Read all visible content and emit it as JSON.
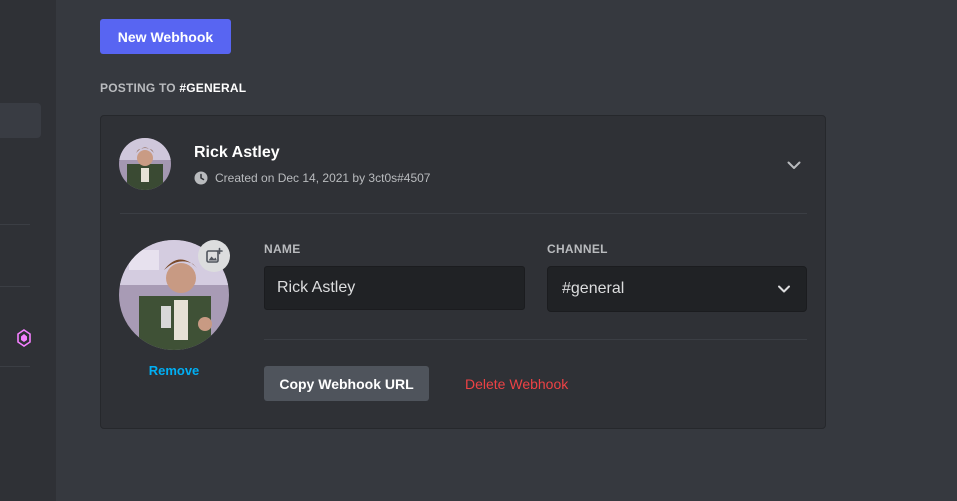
{
  "header": {
    "new_webhook_label": "New Webhook",
    "posting_prefix": "POSTING TO ",
    "posting_channel": "#GENERAL"
  },
  "webhook": {
    "name": "Rick Astley",
    "meta": "Created on Dec 14, 2021 by 3ct0s#4507",
    "remove_label": "Remove",
    "name_label": "NAME",
    "name_value": "Rick Astley",
    "channel_label": "CHANNEL",
    "channel_value": "#general",
    "copy_url_label": "Copy Webhook URL",
    "delete_label": "Delete Webhook"
  },
  "icons": {
    "clock": "clock-icon",
    "chevron": "chevron-down-icon",
    "upload": "image-plus-icon",
    "nitro": "nitro-gem-icon"
  },
  "colors": {
    "blurple": "#5865f2",
    "link": "#00aff4",
    "danger": "#ed4245",
    "nitro": "#f47fff"
  }
}
